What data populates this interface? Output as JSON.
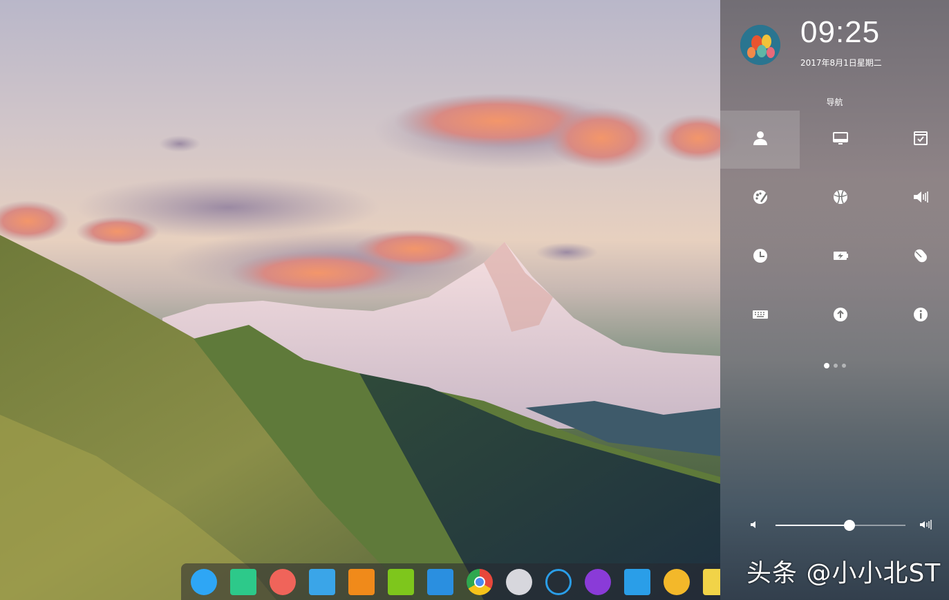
{
  "panel": {
    "time": "09:25",
    "date": "2017年8月1日星期二",
    "nav_title": "导航",
    "grid": [
      {
        "icon": "user-account-icon",
        "active": true
      },
      {
        "icon": "display-icon",
        "active": false
      },
      {
        "icon": "default-apps-icon",
        "active": false
      },
      {
        "icon": "personalization-icon",
        "active": false
      },
      {
        "icon": "network-icon",
        "active": false
      },
      {
        "icon": "sound-icon",
        "active": false
      },
      {
        "icon": "time-date-icon",
        "active": false
      },
      {
        "icon": "power-management-icon",
        "active": false
      },
      {
        "icon": "mouse-icon",
        "active": false
      },
      {
        "icon": "keyboard-icon",
        "active": false
      },
      {
        "icon": "update-icon",
        "active": false
      },
      {
        "icon": "system-info-icon",
        "active": false
      }
    ],
    "page_indicator": {
      "pages": 3,
      "current": 1
    },
    "volume": {
      "level": 0.57
    }
  },
  "dock": {
    "apps": [
      {
        "icon": "launcher-icon",
        "color": "#2ea6f5"
      },
      {
        "icon": "file-manager-icon",
        "color": "#2dc98a"
      },
      {
        "icon": "screen-recorder-icon",
        "color": "#f0645a"
      },
      {
        "icon": "app-store-icon",
        "color": "#3aa5e8"
      },
      {
        "icon": "shopping-icon",
        "color": "#f08a1a"
      },
      {
        "icon": "music-icon",
        "color": "#7ec61c"
      },
      {
        "icon": "video-player-icon",
        "color": "#2a8fe0"
      },
      {
        "icon": "chrome-icon",
        "color": "#e7473b"
      },
      {
        "icon": "settings-icon",
        "color": "#d7d7dd"
      },
      {
        "icon": "deepin-icon",
        "color": "#2a9ee8"
      },
      {
        "icon": "shutdown-icon",
        "color": "#8a3bd8"
      },
      {
        "icon": "task-manager-icon",
        "color": "#2a9ee8"
      },
      {
        "icon": "clock-icon",
        "color": "#f3b82a"
      },
      {
        "icon": "calendar-icon",
        "color": "#f1d348"
      }
    ]
  },
  "watermark": "头条 @小小北ST"
}
